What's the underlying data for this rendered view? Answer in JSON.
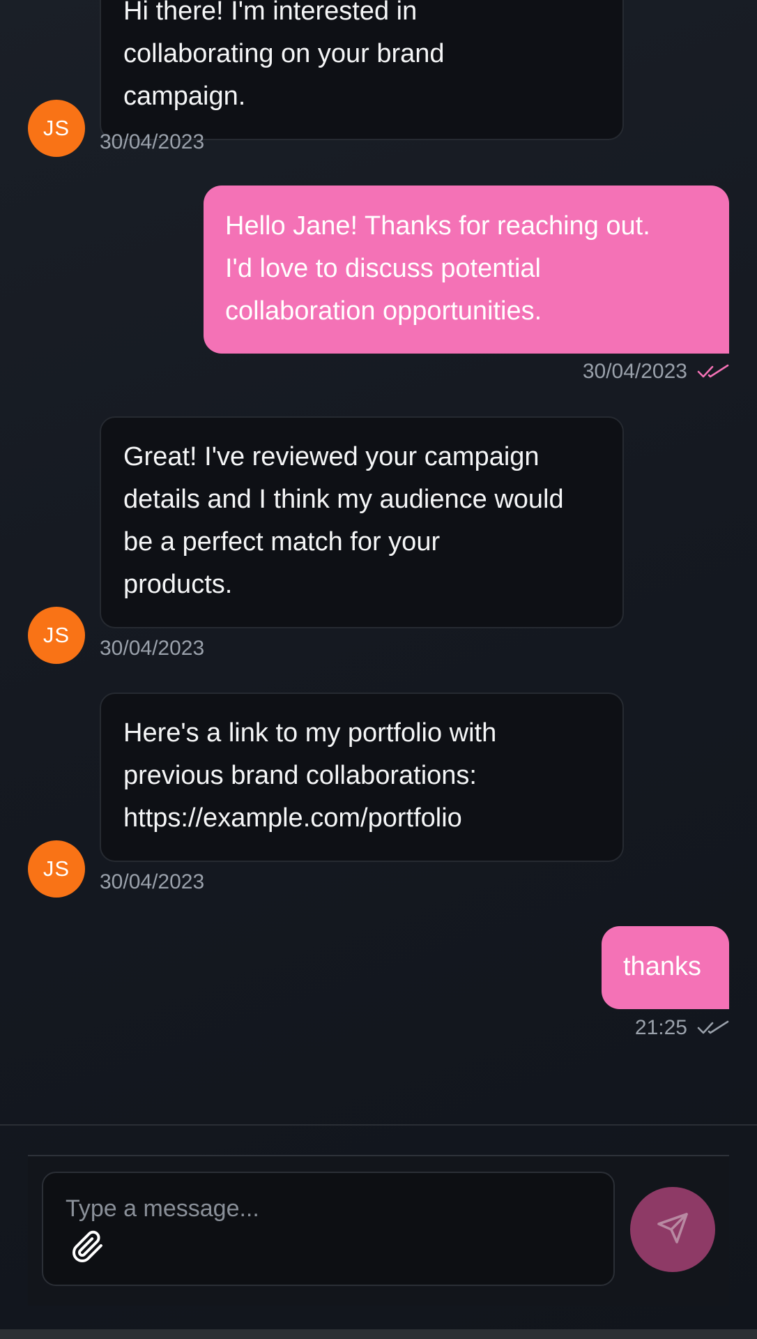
{
  "contact": {
    "initials": "JS"
  },
  "messages": [
    {
      "direction": "incoming",
      "text_lines": [
        "Hi there! I'm interested in",
        "collaborating on your brand",
        "campaign."
      ],
      "time": "30/04/2023"
    },
    {
      "direction": "outgoing",
      "text_lines": [
        "Hello Jane! Thanks for reaching out.",
        "I'd love to discuss potential",
        "collaboration opportunities."
      ],
      "time": "30/04/2023",
      "status": "read",
      "status_color": "#f472b6"
    },
    {
      "direction": "incoming",
      "text_lines": [
        "Great! I've reviewed your campaign",
        "details and I think my audience would",
        "be a perfect match for your",
        "products."
      ],
      "time": "30/04/2023"
    },
    {
      "direction": "incoming",
      "text_lines": [
        "Here's a link to my portfolio with",
        "previous brand collaborations:",
        "https://example.com/portfolio"
      ],
      "time": "30/04/2023"
    },
    {
      "direction": "outgoing",
      "text_lines": [
        "thanks"
      ],
      "time": "21:25",
      "status": "delivered",
      "status_color": "#9aa1ab"
    }
  ],
  "composer": {
    "placeholder": "Type a message...",
    "attach_icon": "paperclip-icon",
    "send_icon": "send-icon"
  },
  "colors": {
    "background": "#151921",
    "outgoing_bubble": "#f472b6",
    "incoming_bubble": "#0e1015",
    "avatar": "#f97316",
    "send_button": "#8e3a66"
  }
}
